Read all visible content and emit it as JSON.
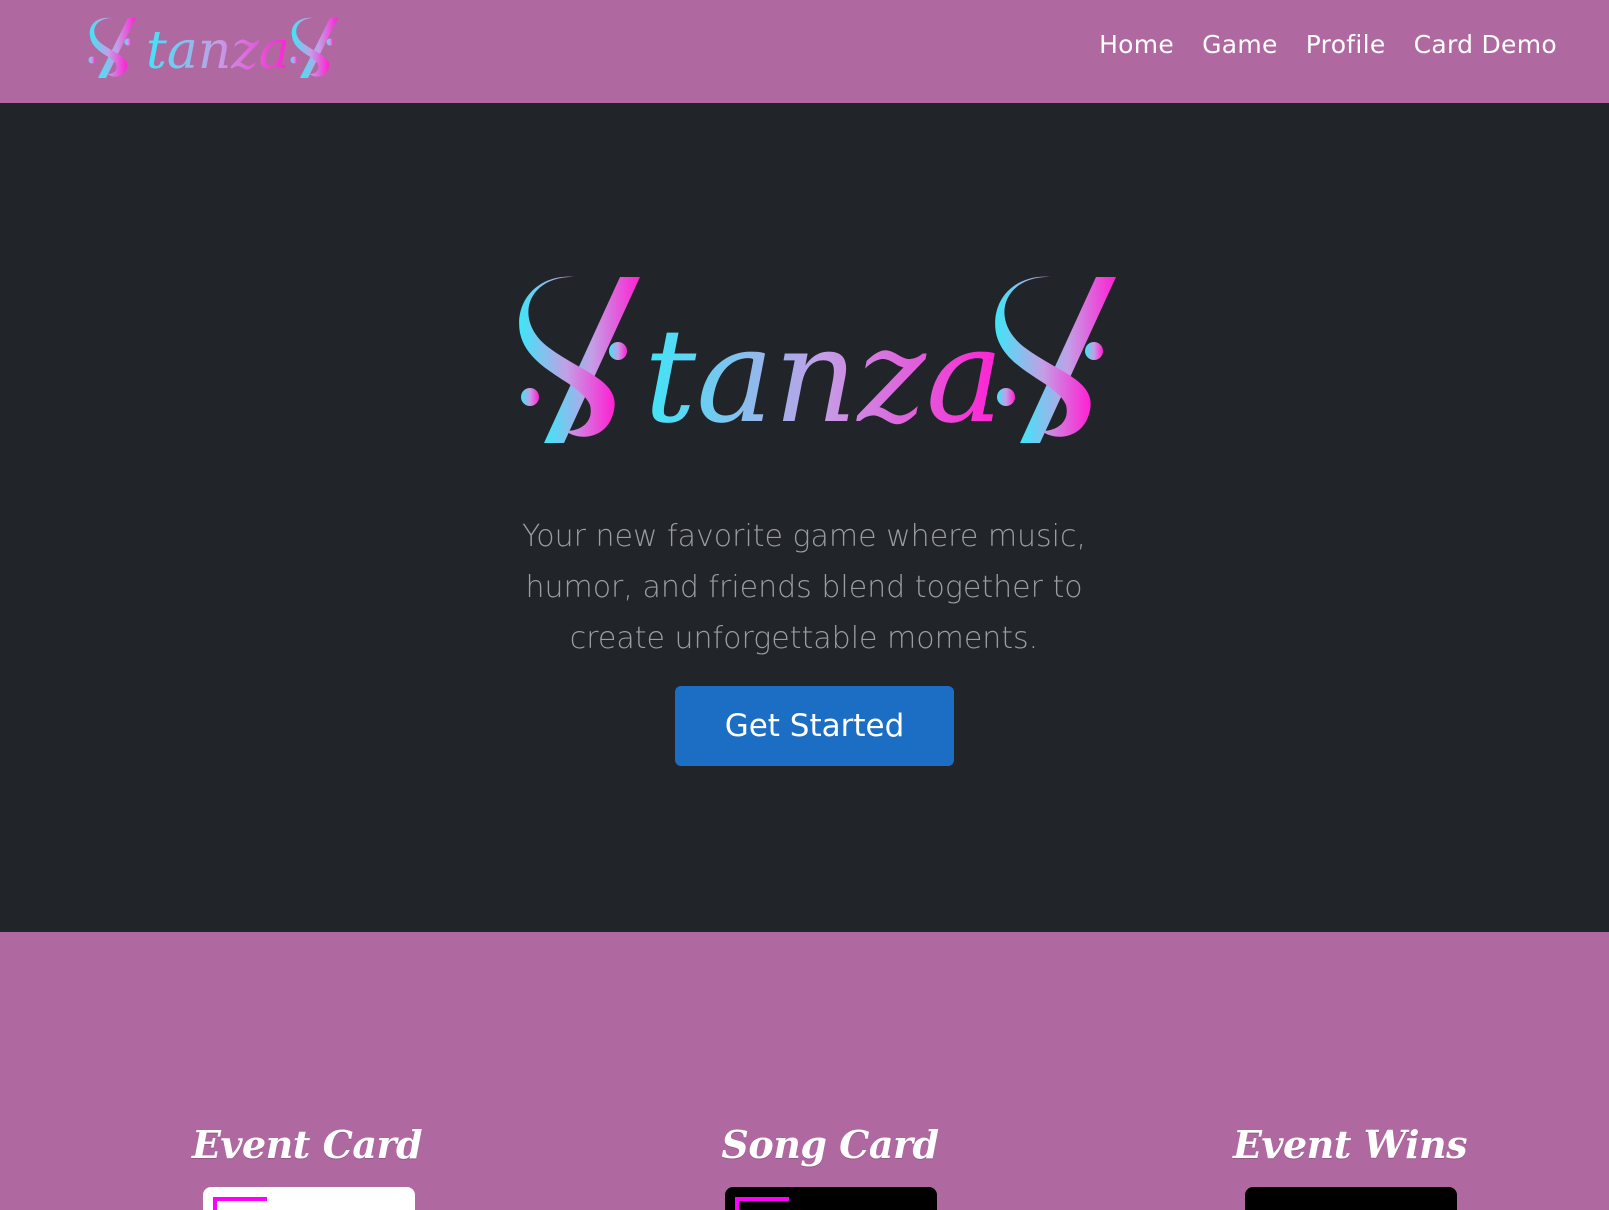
{
  "brand": {
    "logo_text": "StanzaS",
    "gradient_start": "#3ee6f7",
    "gradient_mid": "#c49ee6",
    "gradient_end": "#ff1fd2"
  },
  "nav": {
    "items": [
      {
        "label": "Home"
      },
      {
        "label": "Game"
      },
      {
        "label": "Profile"
      },
      {
        "label": "Card Demo"
      }
    ]
  },
  "hero": {
    "tagline": "Your new favorite game where music, humor, and friends blend together to create unforgettable moments.",
    "cta_label": "Get Started"
  },
  "features": [
    {
      "title": "Event Card",
      "card_color": "#ffffff"
    },
    {
      "title": "Song Card",
      "card_color": "#000000"
    },
    {
      "title": "Event Wins",
      "card_color": "#000000"
    }
  ],
  "colors": {
    "nav_bg": "#b069a0",
    "hero_bg": "#212429",
    "cta_bg": "#1c6ec4",
    "accent": "#ff00ff"
  }
}
